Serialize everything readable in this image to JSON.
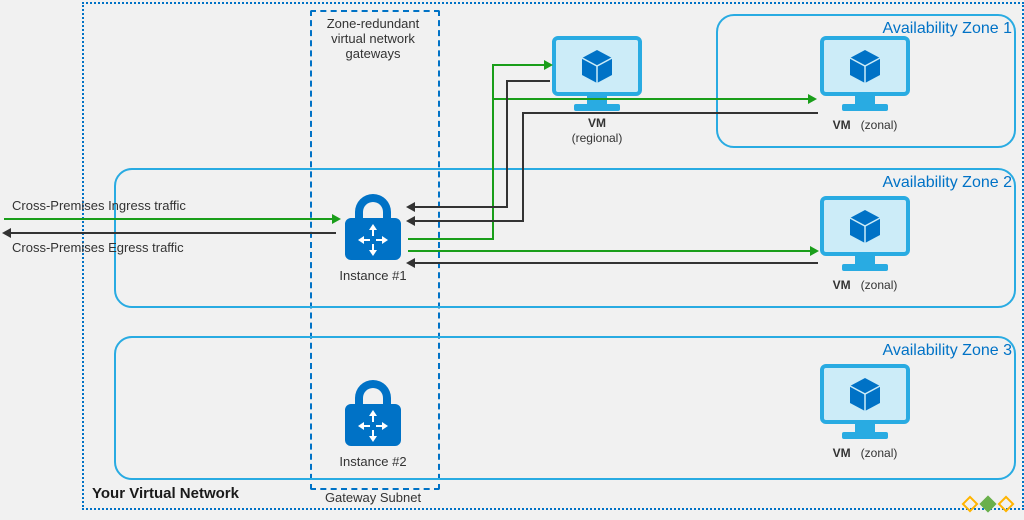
{
  "diagram": {
    "vnet_label": "Your Virtual Network",
    "gateway_subnet": {
      "title_line1": "Zone-redundant",
      "title_line2": "virtual network",
      "title_line3": "gateways",
      "caption": "Gateway Subnet",
      "instances": [
        {
          "label": "Instance #1"
        },
        {
          "label": "Instance #2"
        }
      ]
    },
    "zones": [
      {
        "title": "Availability Zone 1",
        "vm_label_bold": "VM",
        "vm_label_rest": "(zonal)"
      },
      {
        "title": "Availability Zone 2",
        "vm_label_bold": "VM",
        "vm_label_rest": "(zonal)"
      },
      {
        "title": "Availability Zone 3",
        "vm_label_bold": "VM",
        "vm_label_rest": "(zonal)"
      }
    ],
    "regional_vm": {
      "label_bold": "VM",
      "label_rest": "(regional)"
    },
    "traffic": {
      "ingress": "Cross-Premises Ingress traffic",
      "egress": "Cross-Premises Egress traffic"
    },
    "colors": {
      "azure_blue": "#0072c6",
      "light_blue": "#29abe2",
      "flow_green": "#1a9e1a",
      "flow_dark": "#333333"
    }
  }
}
